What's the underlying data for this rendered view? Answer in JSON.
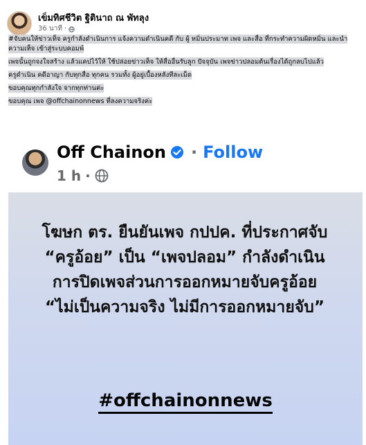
{
  "post": {
    "author": "เข็มทิศชีวิต ฐิตินาถ ณ พัทลุง",
    "time": "36 นาที",
    "privacy_icon": "globe-icon",
    "caption_lines": [
      "#จับคนให้ข่าวเท็จ ครูกำลังดำเนินการ แจ้งความดำเนินคดี กับ ผู้ หมิ่นประมาท เพจ และสื่อ ที่กระทำความผิดหมิ่น และนำความเท็จ เข้าสู่ระบบคอมพ์",
      "เพจนั้นถูกจงใจสร้าง แล้วแคปไว้ให้ ใช้ปล่อยข่าวเท็จ ให้สื่ออื่นรับลูก ปัจจุบัน เพจข่าวปลอมต้นเรื่องได้ถูกลบไปแล้ว",
      "ครูดำเนิน คดีอาญา กับทุกสื่อ ทุกคน รวมทั้ง ผู้อยู่เบื้องหลังทีละเม็ด",
      "ขอบคุณทุกกำลังใจ จากทุกท่านค่ะ",
      "ขอบคุณ เพจ @offchainonnews ที่ลงความจริงค่ะ"
    ]
  },
  "shared": {
    "page_name": "Off Chainon",
    "verified_icon": "verified-badge-icon",
    "separator": "·",
    "follow_label": "Follow",
    "time": "1 h",
    "meta_separator": "·",
    "privacy_icon": "globe-icon",
    "quote": "โฆษก ตร. ยืนยันเพจ กปปค. ที่ประกาศจับ “ครูอ้อย” เป็น “เพจปลอม” กำลังดำเนินการปิดเพจส่วนการออกหมายจับครูอ้อย “ไม่เป็นความจริง ไม่มีการออกหมายจับ”",
    "hashtag": "#offchainonnews"
  },
  "colors": {
    "follow": "#1877f2",
    "meta": "#65676b",
    "highlight": "#d7d8dc",
    "quote_bg": "#cfd8ee"
  }
}
